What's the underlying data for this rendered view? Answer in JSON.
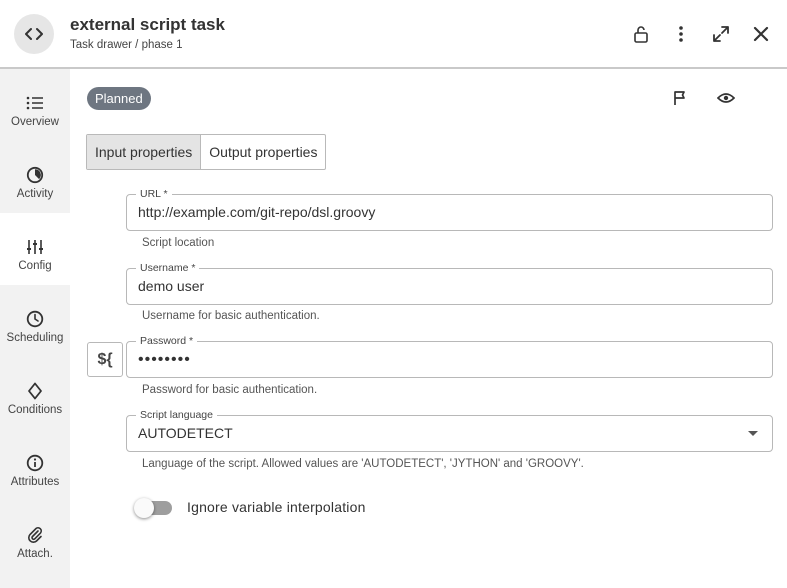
{
  "header": {
    "title": "external script task",
    "subtitle": "Task drawer / phase 1",
    "icons": [
      "code-icon",
      "lock-open-icon",
      "more-vert-icon",
      "expand-icon",
      "close-icon"
    ]
  },
  "sidebar": {
    "items": [
      {
        "label": "Overview",
        "icon": "list-icon"
      },
      {
        "label": "Activity",
        "icon": "activity-icon"
      },
      {
        "label": "Config",
        "icon": "sliders-icon",
        "active": true
      },
      {
        "label": "Scheduling",
        "icon": "clock-icon"
      },
      {
        "label": "Conditions",
        "icon": "diamond-icon"
      },
      {
        "label": "Attributes",
        "icon": "info-icon"
      },
      {
        "label": "Attach.",
        "icon": "paperclip-icon"
      }
    ]
  },
  "status": {
    "label": "Planned",
    "color": "#6e7681"
  },
  "actions": {
    "icons": [
      "flag-icon",
      "eye-icon"
    ]
  },
  "tabs": [
    {
      "label": "Input properties",
      "active": true
    },
    {
      "label": "Output properties",
      "active": false
    }
  ],
  "form": {
    "url": {
      "label": "URL *",
      "value": "http://example.com/git-repo/dsl.groovy",
      "helper": "Script location"
    },
    "username": {
      "label": "Username *",
      "value": "demo user",
      "helper": "Username for basic authentication."
    },
    "password": {
      "label": "Password *",
      "value": "••••••••",
      "helper": "Password for basic authentication."
    },
    "variable_button": "${",
    "script_language": {
      "label": "Script language",
      "value": "AUTODETECT",
      "helper": "Language of the script. Allowed values are 'AUTODETECT', 'JYTHON' and 'GROOVY'."
    },
    "ignore_interpolation": {
      "label": "Ignore variable interpolation",
      "checked": false
    }
  }
}
